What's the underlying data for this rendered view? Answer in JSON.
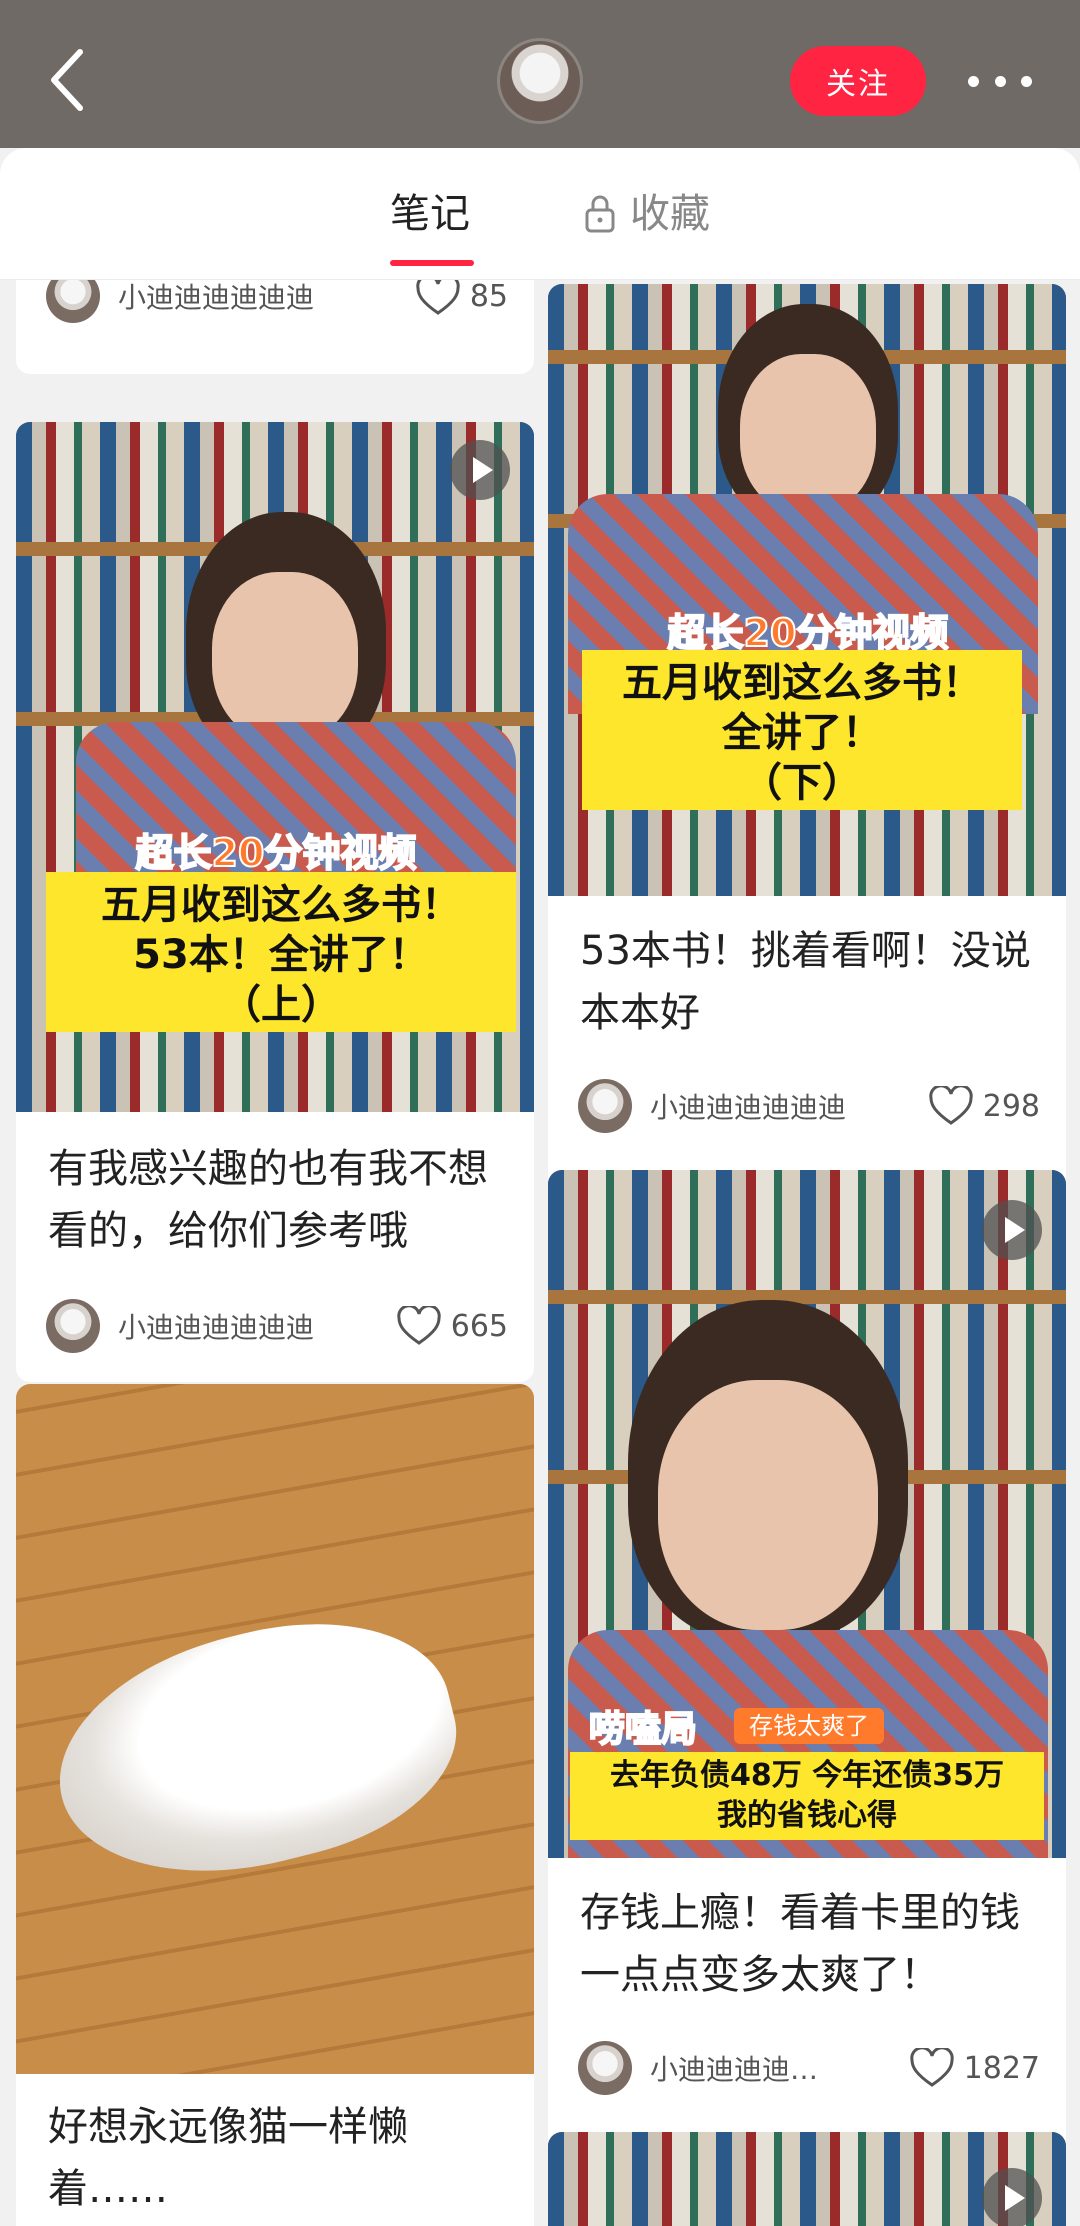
{
  "header": {
    "follow_label": "关注"
  },
  "tabs": {
    "notes_label": "笔记",
    "collect_label": "收藏"
  },
  "cards": {
    "c0": {
      "author": "小迪迪迪迪迪迪",
      "likes": "85"
    },
    "c1": {
      "overlay_top": "超长20分钟视频",
      "overlay_line1": "五月收到这么多书！",
      "overlay_line2": "53本！全讲了！",
      "overlay_line3": "（上）",
      "title": "有我感兴趣的也有我不想看的，给你们参考哦",
      "author": "小迪迪迪迪迪迪",
      "likes": "665"
    },
    "c2": {
      "title": "好想永远像猫一样懒着……"
    },
    "c3": {
      "overlay_top": "超长20分钟视频",
      "overlay_line1": "五月收到这么多书！",
      "overlay_line2": "全讲了！",
      "overlay_line3": "（下）",
      "title": "53本书！挑着看啊！没说本本好",
      "author": "小迪迪迪迪迪迪",
      "likes": "298"
    },
    "c4": {
      "overlay_tag": "唠嗑局",
      "overlay_sub": "存钱太爽了",
      "overlay_line1": "去年负债48万 今年还债35万",
      "overlay_line2": "我的省钱心得",
      "title": "存钱上瘾！看着卡里的钱一点点变多太爽了！",
      "author": "小迪迪迪迪…",
      "likes": "1827"
    }
  },
  "colors": {
    "accent": "#ff2442",
    "banner": "#fde62c"
  },
  "icons": [
    "back-arrow-icon",
    "more-icon",
    "lock-icon",
    "heart-icon",
    "play-icon"
  ]
}
